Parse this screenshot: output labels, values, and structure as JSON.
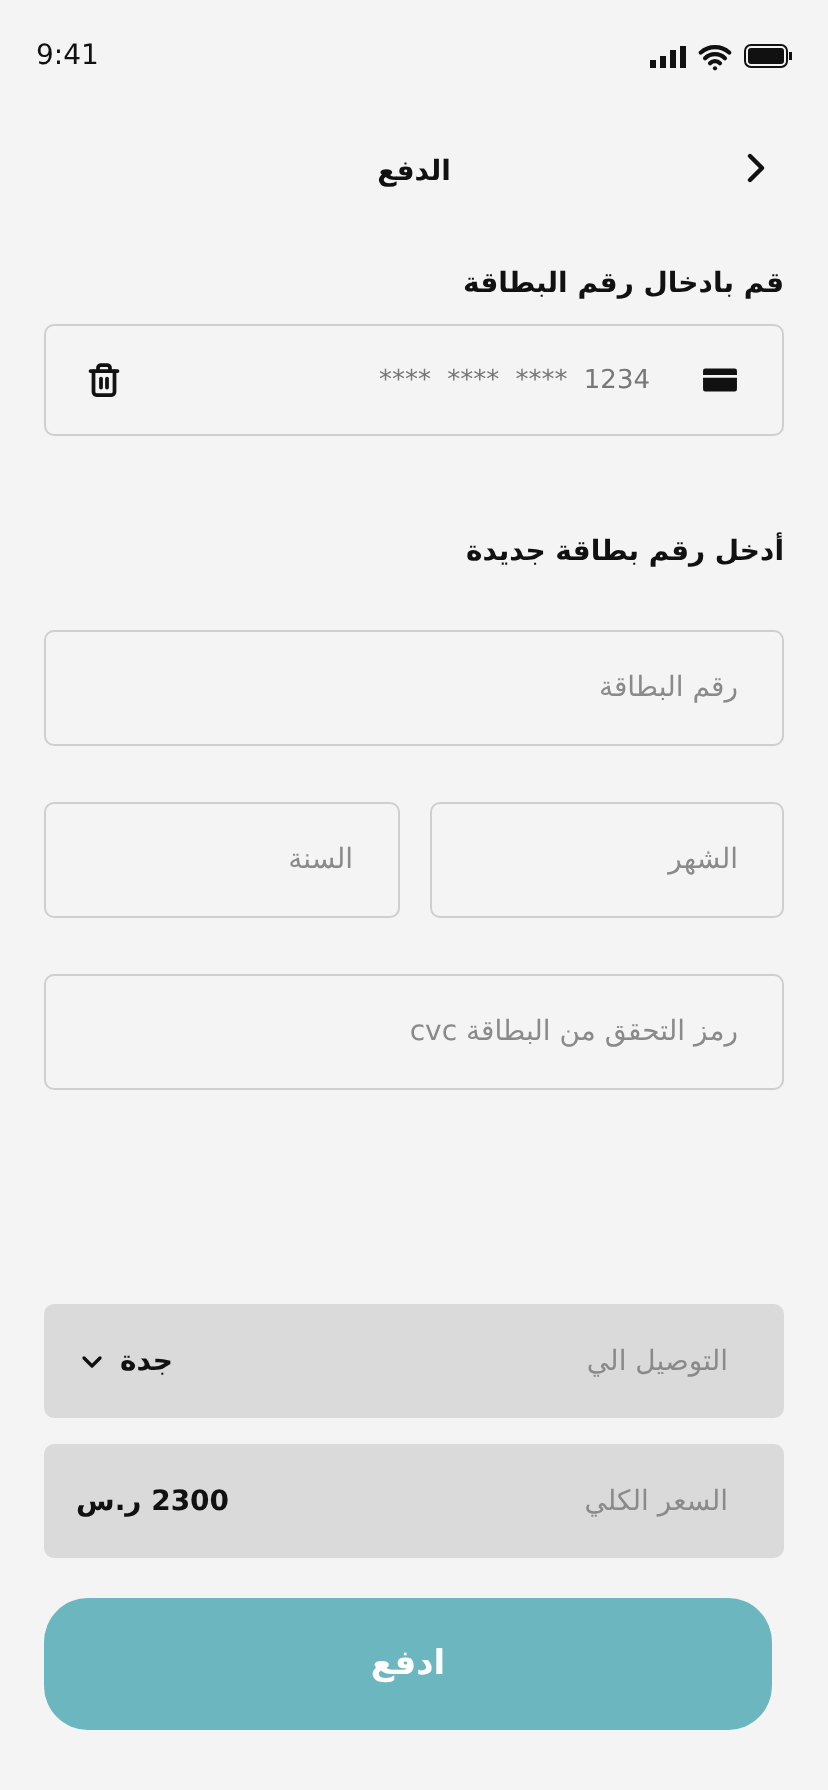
{
  "status_bar": {
    "time": "9:41"
  },
  "header": {
    "title": "الدفع"
  },
  "saved_card": {
    "label": "قم بادخال رقم البطاقة",
    "number": "**** **** **** 1234"
  },
  "new_card": {
    "label": "أدخل رقم بطاقة جديدة",
    "fields": [
      {
        "placeholder": "رقم البطاقة"
      }
    ],
    "row_fields": [
      {
        "placeholder": "الشهر"
      },
      {
        "placeholder": "السنة"
      }
    ],
    "cvc": {
      "placeholder": "رمز التحقق من البطاقة cvc"
    }
  },
  "delivery": {
    "label": "التوصيل الي",
    "value": "جدة"
  },
  "total": {
    "label": "السعر الكلي",
    "value": "2300 ر.س"
  },
  "pay_button": "ادفع"
}
